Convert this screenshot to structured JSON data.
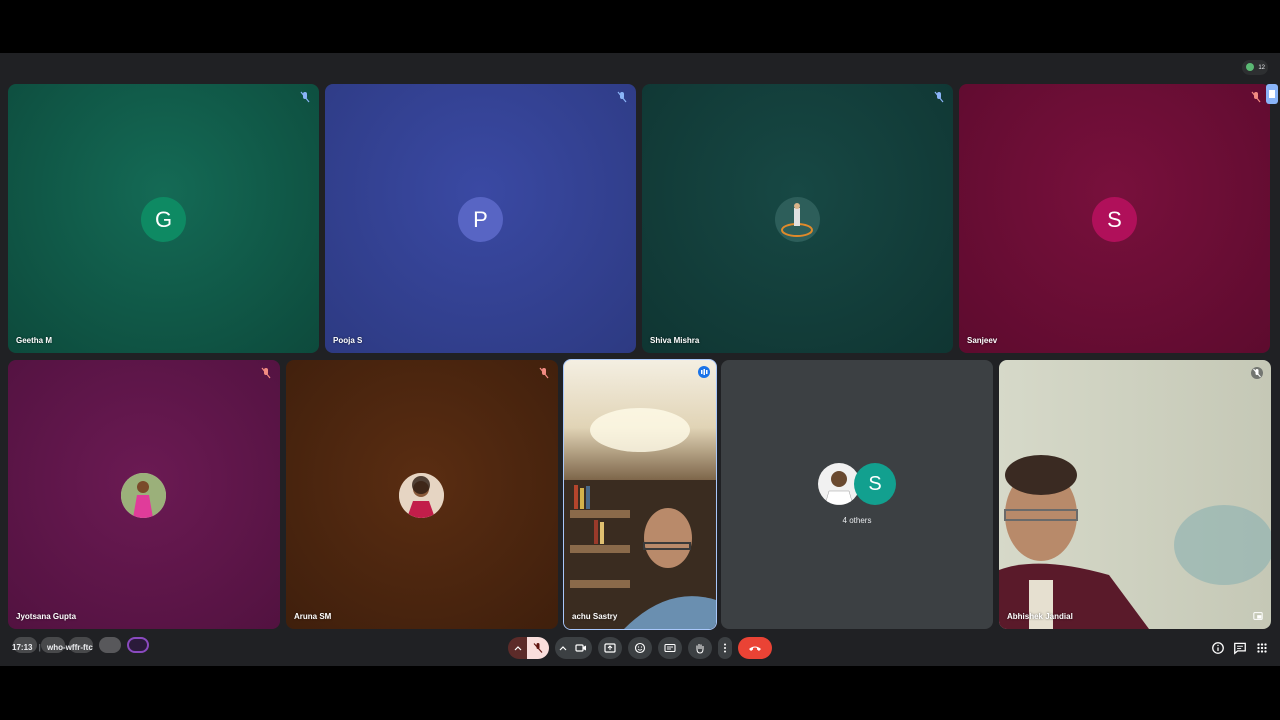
{
  "participants_count": "12",
  "tiles": [
    {
      "name": "Geetha M",
      "initial": "G",
      "color": "#0f5d4b",
      "avatar_color": "#0e8a63"
    },
    {
      "name": "Pooja S",
      "initial": "P",
      "color": "#33418f",
      "avatar_color": "#5865c4"
    },
    {
      "name": "Shiva Mishra",
      "initial": "",
      "color": "#123d3a"
    },
    {
      "name": "Sanjeev",
      "initial": "S",
      "color": "#680c33",
      "avatar_color": "#b0105a"
    },
    {
      "name": "Jyotsana Gupta",
      "initial": "",
      "color": "#5c1346"
    },
    {
      "name": "Aruna SM",
      "initial": "",
      "color": "#4a2410"
    },
    {
      "name": "achu Sastry",
      "initial": "",
      "color": "#d8c8a6"
    },
    {
      "name": "Abhishek Jandial",
      "initial": "",
      "color": "#bfc3b0"
    }
  ],
  "others": {
    "label": "4 others",
    "initial": "S",
    "avatar_color": "#12a08f"
  },
  "footer": {
    "time": "17:13",
    "separator": "|",
    "meeting_code": "who-wffr-ftc"
  },
  "colors": {
    "end_call": "#ea4335",
    "mic_off_bg": "#f28b82"
  },
  "icons": [
    "mic-off-icon",
    "camera-icon",
    "present-icon",
    "emoji-icon",
    "captions-icon",
    "raise-hand-icon",
    "more-icon",
    "end-call-icon",
    "info-icon",
    "chat-icon",
    "activities-icon"
  ]
}
